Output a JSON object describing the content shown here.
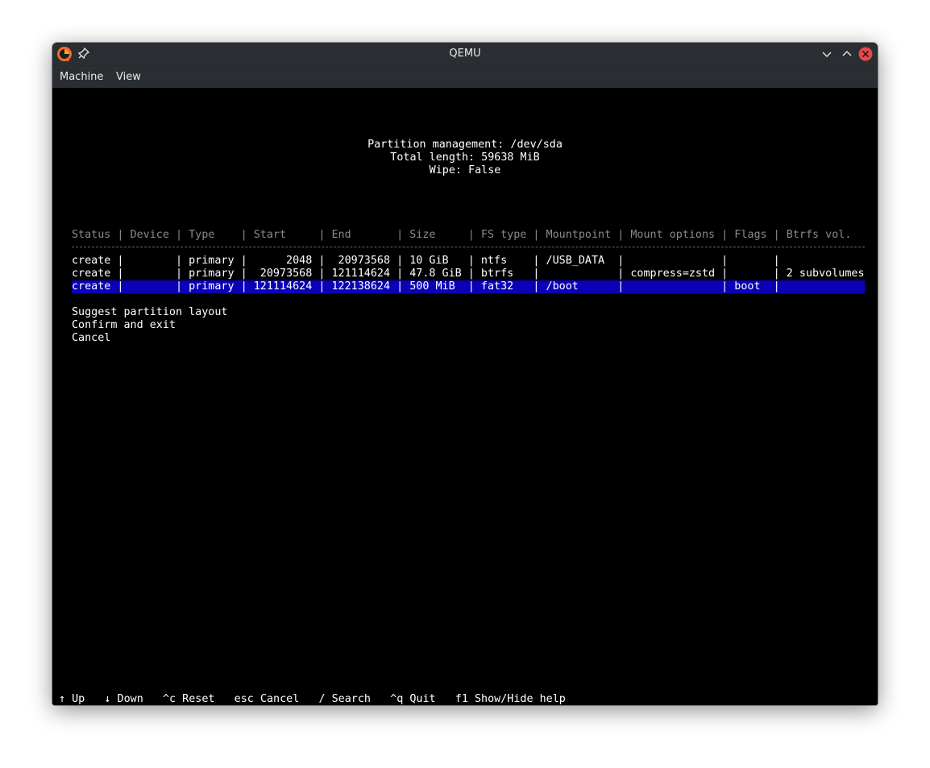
{
  "window": {
    "title": "QEMU",
    "menu": [
      "Machine",
      "View"
    ]
  },
  "header": {
    "line1": "Partition management: /dev/sda",
    "line2": "Total length: 59638 MiB",
    "line3": "Wipe: False"
  },
  "table": {
    "header": "Status | Device | Type    | Start     | End       | Size     | FS type | Mountpoint | Mount options | Flags | Btrfs vol.",
    "rows": [
      "create |        | primary |      2048 |  20973568 | 10 GiB   | ntfs    | /USB_DATA  |               |       |",
      "create |        | primary |  20973568 | 121114624 | 47.8 GiB | btrfs   |            | compress=zstd |       | 2 subvolumes",
      "create |        | primary | 121114624 | 122138624 | 500 MiB  | fat32   | /boot      |               | boot  |"
    ],
    "selected_row": 2
  },
  "actions": [
    "Suggest partition layout",
    "Confirm and exit",
    "Cancel"
  ],
  "footer": "↑ Up   ↓ Down   ^c Reset   esc Cancel   / Search   ^q Quit   f1 Show/Hide help",
  "colors": {
    "selection": "#0b00b7",
    "titlebar": "#2a2e32",
    "close_button": "#e5484d"
  }
}
